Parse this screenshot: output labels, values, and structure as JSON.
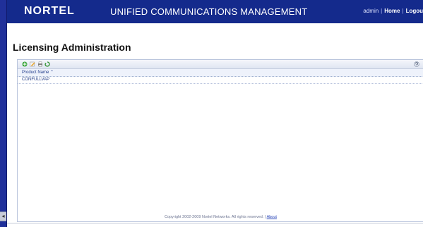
{
  "header": {
    "logo": "NORTEL",
    "title": "UNIFIED COMMUNICATIONS MANAGEMENT",
    "user": "admin",
    "home_link": "Home",
    "logout_link": "Logou"
  },
  "page": {
    "title": "Licensing Administration"
  },
  "toolbar": {
    "icons": [
      "add-icon",
      "edit-icon",
      "print-icon",
      "refresh-icon",
      "help-icon"
    ]
  },
  "table": {
    "columns": [
      "Product Name ⌃"
    ],
    "rows": [
      [
        "CONFULLVAP"
      ]
    ]
  },
  "footer": {
    "copyright": "Copyright 2002-2009 Nortel Networks. All rights reserved.",
    "about_link": "About"
  },
  "colors": {
    "header_bg": "#142a8c",
    "accent": "#1f3a8a"
  }
}
